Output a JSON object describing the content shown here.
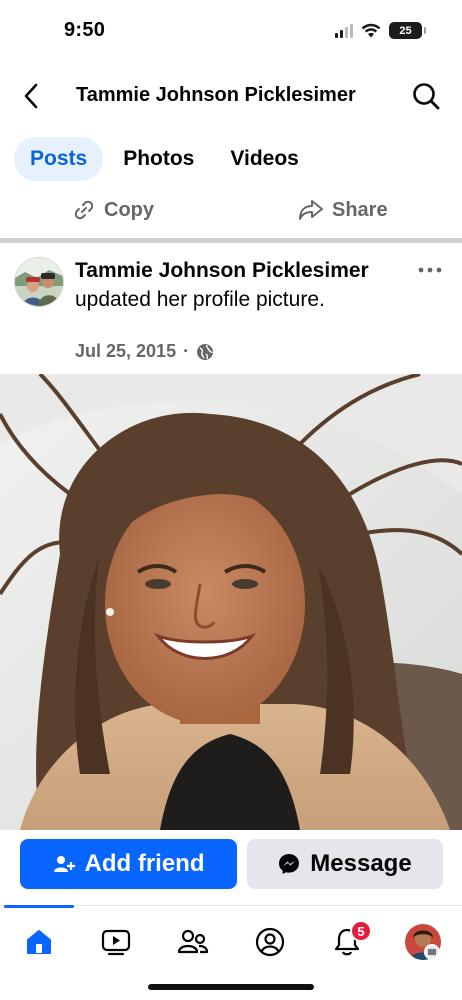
{
  "status_bar": {
    "time": "9:50",
    "battery": "25"
  },
  "header": {
    "title": "Tammie Johnson Picklesimer"
  },
  "tabs": [
    {
      "label": "Posts",
      "active": true
    },
    {
      "label": "Photos",
      "active": false
    },
    {
      "label": "Videos",
      "active": false
    }
  ],
  "actions": {
    "copy_label": "Copy",
    "share_label": "Share"
  },
  "post": {
    "author": "Tammie Johnson Picklesimer",
    "action_text": " updated her profile picture.",
    "date": "Jul 25, 2015",
    "separator": "·",
    "audience_icon": "globe-icon"
  },
  "buttons": {
    "add_friend": "Add friend",
    "message": "Message"
  },
  "bottom_nav": {
    "items": [
      "home-icon",
      "video-icon",
      "friends-icon",
      "profile-icon",
      "notifications-icon",
      "menu-avatar"
    ],
    "notification_count": "5"
  },
  "colors": {
    "accent": "#0866ff",
    "active_tab_bg": "#e7f0fd",
    "secondary_text": "#65676b",
    "badge": "#e41e3f"
  }
}
